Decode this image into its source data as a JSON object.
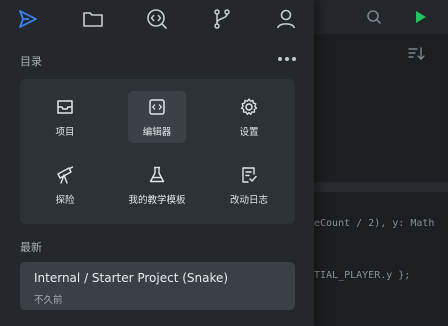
{
  "nav": {
    "items": [
      {
        "icon": "send-icon",
        "active": true
      },
      {
        "icon": "folder-icon"
      },
      {
        "icon": "search-code-icon"
      },
      {
        "icon": "git-branch-icon"
      },
      {
        "icon": "user-icon"
      }
    ],
    "accent": "#3b82f6"
  },
  "directory": {
    "title": "目录",
    "more_icon": "more-horizontal-icon",
    "tiles": [
      {
        "label": "项目",
        "icon": "inbox-icon"
      },
      {
        "label": "编辑器",
        "icon": "code-icon",
        "active": true
      },
      {
        "label": "设置",
        "icon": "gear-icon"
      },
      {
        "label": "探险",
        "icon": "telescope-icon"
      },
      {
        "label": "我的教学模板",
        "icon": "flask-icon"
      },
      {
        "label": "改动日志",
        "icon": "changelog-icon"
      }
    ]
  },
  "recent": {
    "title": "最新",
    "items": [
      {
        "name": "Internal / Starter Project (Snake)",
        "time": "不久前"
      }
    ]
  },
  "editor": {
    "code_lines": [
      "eCount / 2), y: Math",
      "TIAL_PLAYER.y };"
    ],
    "run_color": "#22c55e"
  }
}
